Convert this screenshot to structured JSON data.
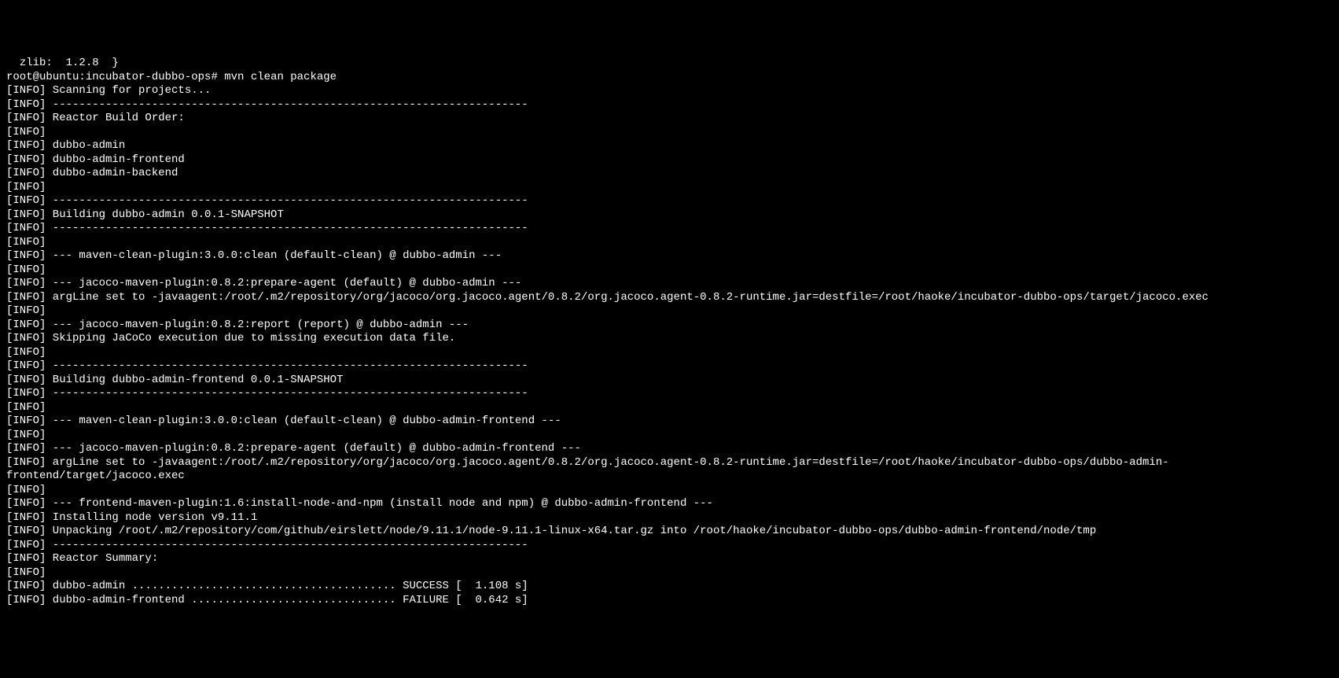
{
  "terminal": {
    "lines": [
      "  zlib:  1.2.8  }",
      "root@ubuntu:incubator-dubbo-ops# mvn clean package",
      "[INFO] Scanning for projects...",
      "[INFO] ------------------------------------------------------------------------",
      "[INFO] Reactor Build Order:",
      "[INFO]",
      "[INFO] dubbo-admin",
      "[INFO] dubbo-admin-frontend",
      "[INFO] dubbo-admin-backend",
      "[INFO]",
      "[INFO] ------------------------------------------------------------------------",
      "[INFO] Building dubbo-admin 0.0.1-SNAPSHOT",
      "[INFO] ------------------------------------------------------------------------",
      "[INFO]",
      "[INFO] --- maven-clean-plugin:3.0.0:clean (default-clean) @ dubbo-admin ---",
      "[INFO]",
      "[INFO] --- jacoco-maven-plugin:0.8.2:prepare-agent (default) @ dubbo-admin ---",
      "[INFO] argLine set to -javaagent:/root/.m2/repository/org/jacoco/org.jacoco.agent/0.8.2/org.jacoco.agent-0.8.2-runtime.jar=destfile=/root/haoke/incubator-dubbo-ops/target/jacoco.exec",
      "[INFO]",
      "[INFO] --- jacoco-maven-plugin:0.8.2:report (report) @ dubbo-admin ---",
      "[INFO] Skipping JaCoCo execution due to missing execution data file.",
      "[INFO]",
      "[INFO] ------------------------------------------------------------------------",
      "[INFO] Building dubbo-admin-frontend 0.0.1-SNAPSHOT",
      "[INFO] ------------------------------------------------------------------------",
      "[INFO]",
      "[INFO] --- maven-clean-plugin:3.0.0:clean (default-clean) @ dubbo-admin-frontend ---",
      "[INFO]",
      "[INFO] --- jacoco-maven-plugin:0.8.2:prepare-agent (default) @ dubbo-admin-frontend ---",
      "[INFO] argLine set to -javaagent:/root/.m2/repository/org/jacoco/org.jacoco.agent/0.8.2/org.jacoco.agent-0.8.2-runtime.jar=destfile=/root/haoke/incubator-dubbo-ops/dubbo-admin-frontend/target/jacoco.exec",
      "[INFO]",
      "[INFO] --- frontend-maven-plugin:1.6:install-node-and-npm (install node and npm) @ dubbo-admin-frontend ---",
      "[INFO] Installing node version v9.11.1",
      "[INFO] Unpacking /root/.m2/repository/com/github/eirslett/node/9.11.1/node-9.11.1-linux-x64.tar.gz into /root/haoke/incubator-dubbo-ops/dubbo-admin-frontend/node/tmp",
      "[INFO] ------------------------------------------------------------------------",
      "[INFO] Reactor Summary:",
      "[INFO]",
      "[INFO] dubbo-admin ........................................ SUCCESS [  1.108 s]",
      "[INFO] dubbo-admin-frontend ............................... FAILURE [  0.642 s]"
    ]
  }
}
